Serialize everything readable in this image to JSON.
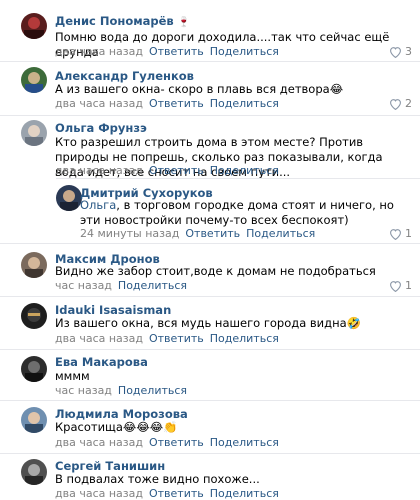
{
  "actions": {
    "reply": "Ответить",
    "share": "Поделиться"
  },
  "comments": [
    {
      "author": "Денис Пономарёв",
      "author_badge": "🍷",
      "text": "Помню вода до дороги доходила....так что сейчас ещё ерунда",
      "time": "два часа назад",
      "likes": "3",
      "has_reply": true
    },
    {
      "author": "Александр Гуленков",
      "text": "А из вашего окна- скоро в плавь вся детвора😂",
      "time": "два часа назад",
      "likes": "2",
      "has_reply": true
    },
    {
      "author": "Ольга Фрунзэ",
      "text": "Кто разрешил строить дома в этом месте? Против природы не попрешь, сколько раз показывали, когда вода идет, все сносит на своем пути...",
      "time": "два часа назад",
      "likes": "",
      "has_reply": true
    },
    {
      "author": "Дмитрий Сухоруков",
      "reply_to": "Ольга",
      "text": ", в торговом городке дома стоят и ничего, но эти новостройки почему-то всех беспокоят)",
      "time": "24 минуты назад",
      "likes": "1",
      "has_reply": true
    },
    {
      "author": "Максим Дронов",
      "text": "Видно же забор стоит,воде к домам не подобраться",
      "time": "час назад",
      "likes": "1",
      "has_reply": false
    },
    {
      "author": "Idauki Isasaisman",
      "text": "Из вашего окна, вся мудь нашего города видна🤣",
      "time": "два часа назад",
      "likes": "",
      "has_reply": true
    },
    {
      "author": "Ева Макарова",
      "text": "мммм",
      "time": "час назад",
      "likes": "",
      "has_reply": false
    },
    {
      "author": "Людмила Морозова",
      "text": "Красотища😂😂😂👏",
      "time": "два часа назад",
      "likes": "",
      "has_reply": true
    },
    {
      "author": "Сергей Танишин",
      "text": "В подвалах тоже видно похоже...",
      "time": "два часа назад",
      "likes": "",
      "has_reply": true
    }
  ],
  "colors": {
    "link": "#2a5885",
    "meta": "#828282",
    "separator": "#e7e8ec"
  }
}
